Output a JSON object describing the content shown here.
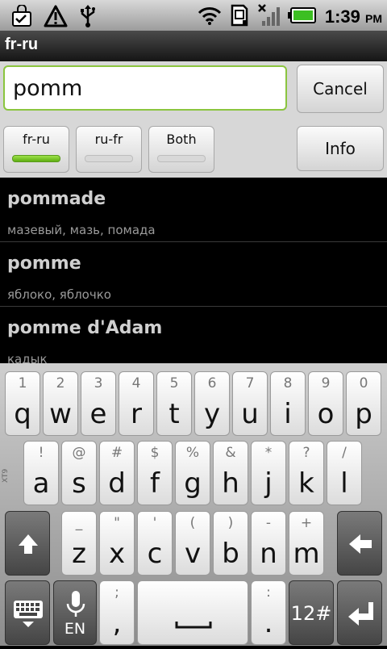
{
  "status_bar": {
    "time": "1:39",
    "ampm": "PM",
    "icons": [
      "shopping-bag-icon",
      "warning-icon",
      "usb-icon",
      "wifi-icon",
      "sd-card-icon",
      "no-signal-icon",
      "battery-icon"
    ]
  },
  "app": {
    "title": "fr-ru"
  },
  "search": {
    "value": "pomm"
  },
  "buttons": {
    "cancel": "Cancel",
    "info": "Info"
  },
  "direction_toggles": [
    {
      "label": "fr-ru",
      "active": true
    },
    {
      "label": "ru-fr",
      "active": false
    },
    {
      "label": "Both",
      "active": false
    }
  ],
  "results": [
    {
      "word": "pommade",
      "translation": "мазевый, мазь, помада"
    },
    {
      "word": "pomme",
      "translation": "яблоко, яблочко"
    },
    {
      "word": "pomme d'Adam",
      "translation": "кадык"
    }
  ],
  "keyboard": {
    "row1": [
      {
        "sub": "1",
        "main": "q"
      },
      {
        "sub": "2",
        "main": "w"
      },
      {
        "sub": "3",
        "main": "e"
      },
      {
        "sub": "4",
        "main": "r"
      },
      {
        "sub": "5",
        "main": "t"
      },
      {
        "sub": "6",
        "main": "y"
      },
      {
        "sub": "7",
        "main": "u"
      },
      {
        "sub": "8",
        "main": "i"
      },
      {
        "sub": "9",
        "main": "o"
      },
      {
        "sub": "0",
        "main": "p"
      }
    ],
    "row2": [
      {
        "sub": "!",
        "main": "a"
      },
      {
        "sub": "@",
        "main": "s"
      },
      {
        "sub": "#",
        "main": "d"
      },
      {
        "sub": "$",
        "main": "f"
      },
      {
        "sub": "%",
        "main": "g"
      },
      {
        "sub": "&",
        "main": "h"
      },
      {
        "sub": "*",
        "main": "j"
      },
      {
        "sub": "?",
        "main": "k"
      },
      {
        "sub": "/",
        "main": "l"
      }
    ],
    "row3": [
      {
        "sub": "_",
        "main": "z"
      },
      {
        "sub": "\"",
        "main": "x"
      },
      {
        "sub": "'",
        "main": "c"
      },
      {
        "sub": "(",
        "main": "v"
      },
      {
        "sub": ")",
        "main": "b"
      },
      {
        "sub": "-",
        "main": "n"
      },
      {
        "sub": "+",
        "main": "m"
      }
    ],
    "semicolon_sub": ";",
    "semicolon_main": ",",
    "colon_sub": ":",
    "colon_main": ".",
    "mic_label": "EN",
    "symbols_label": "12#",
    "side_label": "XT9"
  },
  "colors": {
    "accent": "#8bc53f",
    "title_bar": "#1e1e1e",
    "panel": "#d7d7d7"
  }
}
